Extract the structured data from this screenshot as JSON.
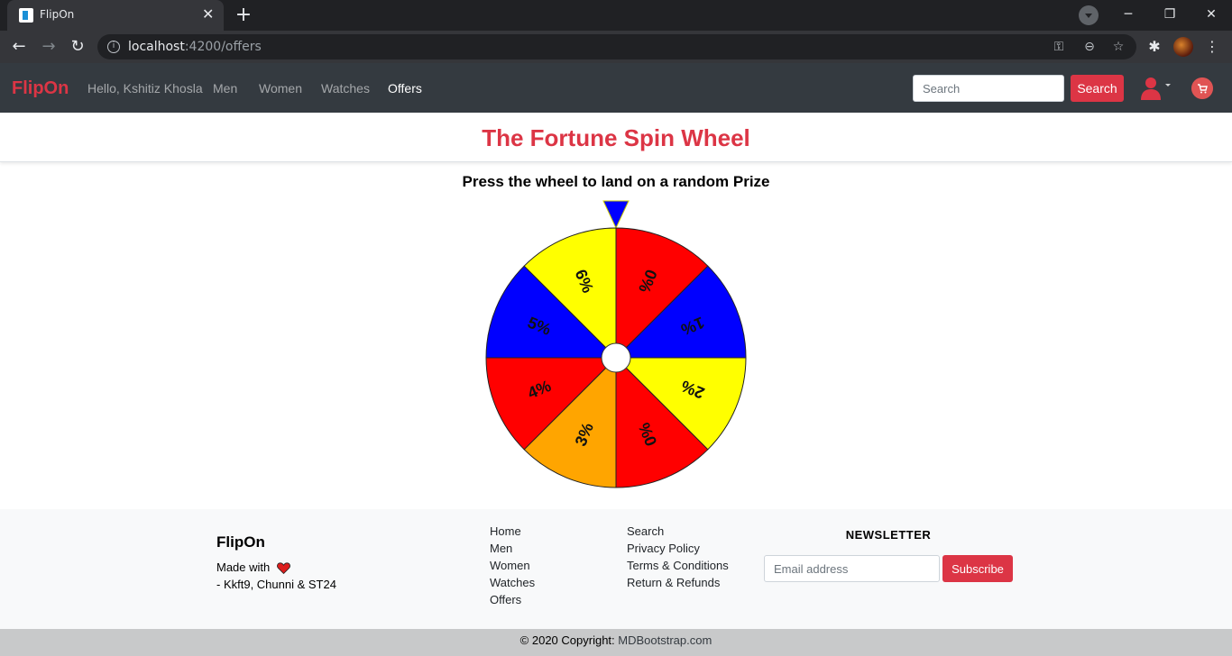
{
  "browser": {
    "tab_title": "FlipOn",
    "tab_close": "✕",
    "new_tab": "+",
    "url_host": "localhost",
    "url_path": ":4200/offers",
    "icons": [
      "back-icon",
      "forward-icon",
      "reload-icon",
      "info-icon",
      "key-icon",
      "zoom-icon",
      "star-icon",
      "extensions-icon",
      "profile-avatar",
      "menu-icon"
    ]
  },
  "navbar": {
    "brand": "FlipOn",
    "greeting": "Hello, Kshitiz Khosla",
    "links": [
      "Men",
      "Women",
      "Watches",
      "Offers"
    ],
    "active_link": "Offers",
    "search_placeholder": "Search",
    "search_button": "Search",
    "accent": "#dc3545"
  },
  "main": {
    "title": "The Fortune Spin Wheel",
    "instruction": "Press the wheel to land on a random Prize",
    "wheel": {
      "segments": [
        {
          "label": "0%",
          "color": "#ff0000"
        },
        {
          "label": "1%",
          "color": "#0000ff"
        },
        {
          "label": "2%",
          "color": "#ffff00"
        },
        {
          "label": "0%",
          "color": "#ff0000"
        },
        {
          "label": "3%",
          "color": "#ffa500"
        },
        {
          "label": "4%",
          "color": "#ff0000"
        },
        {
          "label": "5%",
          "color": "#0000ff"
        },
        {
          "label": "6%",
          "color": "#ffff00"
        }
      ],
      "pointer_color": "#0000ff"
    }
  },
  "footer": {
    "brand": "FlipOn",
    "made_with": "Made with",
    "authors": "- Kkft9, Chunni & ST24",
    "col1": [
      "Home",
      "Men",
      "Women",
      "Watches",
      "Offers"
    ],
    "col2": [
      "Search",
      "Privacy Policy",
      "Terms & Conditions",
      "Return & Refunds"
    ],
    "newsletter_title": "NEWSLETTER",
    "email_placeholder": "Email address",
    "subscribe_button": "Subscribe",
    "copyright_text": "© 2020 Copyright:",
    "copyright_link": "MDBootstrap.com"
  }
}
